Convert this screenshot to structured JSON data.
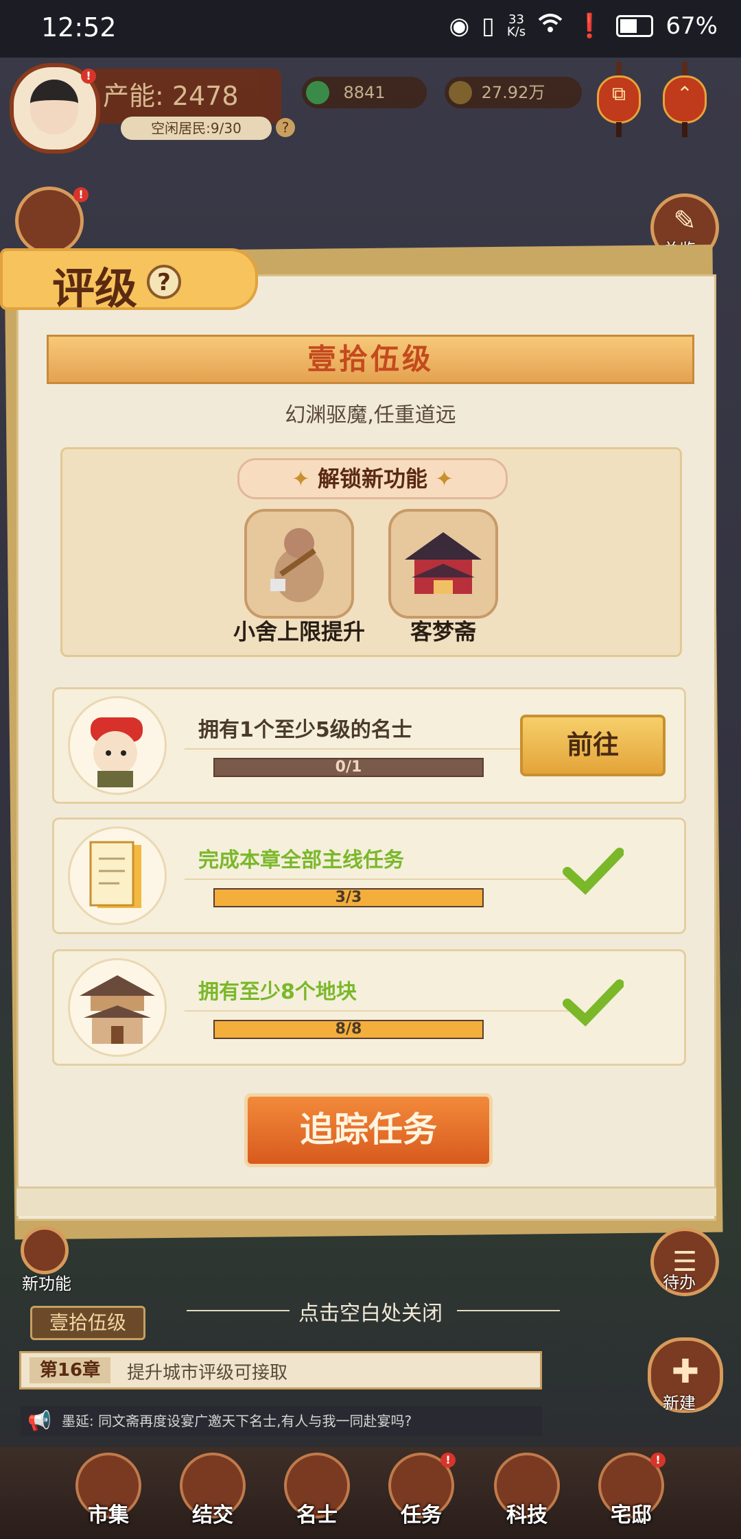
{
  "status_bar": {
    "time": "12:52",
    "speed_value": "33",
    "speed_unit": "K/s",
    "battery": "67%",
    "battery_level": 0.67
  },
  "hud": {
    "capacity": "产能: 2478",
    "idle_residents": "空闲居民:9/30",
    "jade": "8841",
    "coins": "27.92万",
    "lantern_top_right_glyph": "⌃"
  },
  "side": {
    "overview_label": "总览",
    "new_feature_label": "新功能",
    "todo_label": "待办",
    "build_label": "新建"
  },
  "panel": {
    "title": "评级",
    "help_glyph": "?",
    "level_banner": "壹拾伍级",
    "subtitle": "幻渊驱魔,任重道远",
    "unlock_title": "解锁新功能",
    "unlock_items": [
      {
        "label": "小舍上限提升",
        "icon": "cottage-axe-icon"
      },
      {
        "label": "客梦斋",
        "icon": "building-icon"
      }
    ],
    "tasks": [
      {
        "text": "拥有1个至少5级的名士",
        "progress": "0/1",
        "fraction": 0,
        "done": false,
        "icon": "scholar-icon"
      },
      {
        "text": "完成本章全部主线任务",
        "progress": "3/3",
        "fraction": 1,
        "done": true,
        "icon": "scroll-icon"
      },
      {
        "text": "拥有至少8个地块",
        "progress": "8/8",
        "fraction": 1,
        "done": true,
        "icon": "pavilion-icon"
      }
    ],
    "go_button": "前往",
    "track_button": "追踪任务"
  },
  "bottom": {
    "close_hint": "点击空白处关闭",
    "level_tag": "壹拾伍级",
    "chapter": "第16章",
    "chapter_hint": "提升城市评级可接取",
    "broadcast": "墨延: 同文斋再度设宴广邀天下名士,有人与我一同赴宴吗?"
  },
  "nav": [
    {
      "label": "市集"
    },
    {
      "label": "结交"
    },
    {
      "label": "名士"
    },
    {
      "label": "任务"
    },
    {
      "label": "科技"
    },
    {
      "label": "宅邸"
    }
  ],
  "colors": {
    "accent_orange": "#d85a1e",
    "done_green": "#7ab82a",
    "progress_fill": "#f4ae3c"
  }
}
